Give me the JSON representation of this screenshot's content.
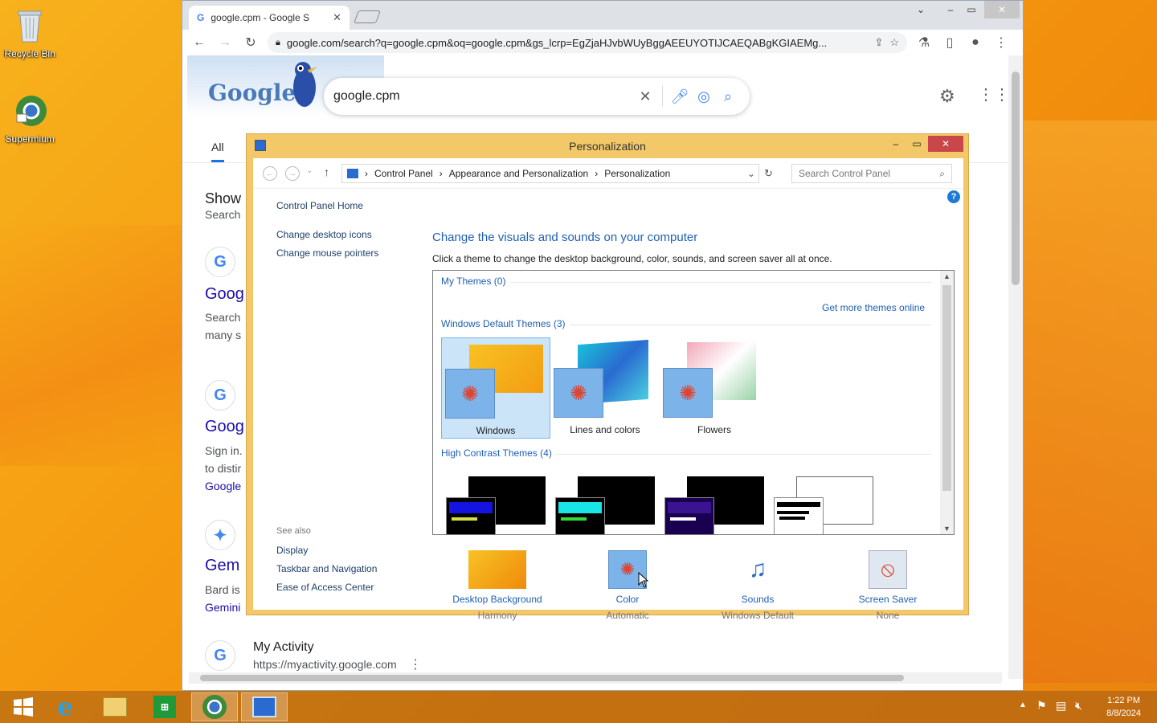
{
  "desktop": {
    "icons": [
      {
        "label": "Recycle Bin"
      },
      {
        "label": "Supermium"
      }
    ]
  },
  "browser": {
    "tab_title": "google.cpm - Google S",
    "url": "google.com/search?q=google.cpm&oq=google.cpm&gs_lcrp=EgZjaHJvbWUyBggAEEUYOTIJCAEQABgKGIAEMg...",
    "search_query": "google.cpm",
    "tab_all_label": "All",
    "results": [
      {
        "title_partial": "Show",
        "text_partial": "Search"
      },
      {
        "title_partial": "Goog",
        "lines": [
          "Search",
          "many s"
        ]
      },
      {
        "title_partial": "Goog",
        "lines": [
          "Sign in.",
          "to distir",
          "Google"
        ]
      },
      {
        "title_partial": "Gem",
        "lines": [
          "Bard is",
          "Gemini"
        ]
      }
    ],
    "my_activity": {
      "title": "My Activity",
      "url": "https://myactivity.google.com"
    }
  },
  "personalization": {
    "window_title": "Personalization",
    "breadcrumb": [
      "Control Panel",
      "Appearance and Personalization",
      "Personalization"
    ],
    "search_placeholder": "Search Control Panel",
    "left_links": {
      "home": "Control Panel Home",
      "desktop_icons": "Change desktop icons",
      "mouse_pointers": "Change mouse pointers"
    },
    "see_also": {
      "label": "See also",
      "items": [
        "Display",
        "Taskbar and Navigation",
        "Ease of Access Center"
      ]
    },
    "heading": "Change the visuals and sounds on your computer",
    "subtitle": "Click a theme to change the desktop background, color, sounds, and screen saver all at once.",
    "my_themes": "My Themes (0)",
    "get_more": "Get more themes online",
    "default_themes_label": "Windows Default Themes (3)",
    "themes": [
      "Windows",
      "Lines and colors",
      "Flowers"
    ],
    "selected_theme": "Windows",
    "high_contrast_label": "High Contrast Themes (4)",
    "bottom": [
      {
        "label": "Desktop Background",
        "sub": "Harmony"
      },
      {
        "label": "Color",
        "sub": "Automatic"
      },
      {
        "label": "Sounds",
        "sub": "Windows Default"
      },
      {
        "label": "Screen Saver",
        "sub": "None"
      }
    ]
  },
  "taskbar": {
    "time": "1:22 PM",
    "date": "8/8/2024"
  },
  "colors": {
    "accent_blue": "#1e5fb4",
    "window_frame": "#f3c869",
    "close_red": "#c9474a"
  }
}
